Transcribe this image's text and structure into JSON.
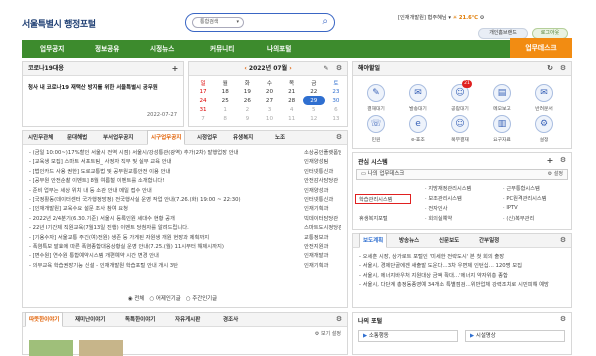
{
  "header": {
    "logo": "서울특별시 행정포털",
    "search_select": "통합검색",
    "user_info": "[인재개발원] 협주혜님",
    "weather": "21.6℃",
    "btn_homepage": "개인홈브랜드",
    "btn_logout": "로그아웃"
  },
  "gnb": {
    "items": [
      "업무공지",
      "정보공유",
      "시정뉴스",
      "커뮤니티",
      "나의포털"
    ],
    "mydesk": "업무데스크"
  },
  "corona": {
    "title": "코로나19대응",
    "text": "청사 내 코로나19 재택산 방지를 위한 서울특별시 공무원",
    "date": "2022-07-27"
  },
  "calendar": {
    "title": "2022년 07월",
    "weekdays": [
      "일",
      "월",
      "화",
      "수",
      "목",
      "금",
      "토"
    ],
    "rows": [
      [
        "17",
        "18",
        "19",
        "20",
        "21",
        "22",
        "23"
      ],
      [
        "24",
        "25",
        "26",
        "27",
        "28",
        "29",
        "30"
      ],
      [
        "31",
        "1",
        "2",
        "3",
        "4",
        "5",
        "6"
      ],
      [
        "7",
        "8",
        "9",
        "10",
        "11",
        "12",
        "13"
      ]
    ]
  },
  "favorites": {
    "title": "해야할일",
    "items": [
      "결재대기",
      "발송대기",
      "공람대기",
      "메모보고",
      "반려문서",
      "민원",
      "e-효조",
      "복무결재",
      "요구자료",
      "설정"
    ],
    "badge": "21"
  },
  "notice": {
    "tabs": [
      "시민무관체",
      "문대해법",
      "부서업무공지",
      "시구업무공지",
      "시정업무",
      "유생복지",
      "노조"
    ],
    "items": [
      {
        "title": "- (금일 10:00~)17%할인 서울시 전역 시점) 서울시/강성통관(광역) 추가(2차) 발행업장 안내",
        "dept": "소상공인플랫폼담당관"
      },
      {
        "title": "- [교육생 모집] 스마트 서포트팀_ 사정자 직무 및 실무 교육 안내",
        "dept": "인재양성팀"
      },
      {
        "title": "- [법인카드 사용 권한] 도로교통법 및 공무원교통안전 이용 안내",
        "dept": "인터넷통신과"
      },
      {
        "title": "- [공무원 안전순찰 이벤트] 8월 여름철 이벤트를 소개합니다!",
        "dept": "안전감사담당관"
      },
      {
        "title": "- 준비 업무는 세상 위치 내 등 소관 안내 메일 접수 안내",
        "dept": "인재양성과"
      },
      {
        "title": "- [국정활동(데이터센터 국가행정망정) 전국행사실 운영 작업 안내(7.26.(화) 19:00 ~ 22:30)",
        "dept": "인터넷통신과"
      },
      {
        "title": "- [인재개발원] 교육수요 설문 조사 참여 요청",
        "dept": "인재기획과"
      },
      {
        "title": "- 2022년 2/4분기(6.30.기준) 서울시 등록인원 세대수 현황 공개",
        "dept": "빅데이터담당관"
      },
      {
        "title": "- 22년 I기간제 직원교육(7월13일 진행) 이벤트 당첨자를 알려드립니다.",
        "dept": "스마트도시정당관"
      },
      {
        "title": "- [기용수자] 서울교통 주긴(여)전원) 생존 등 가게된 자원생 개원 현장과 제획까지",
        "dept": "교통정보과"
      },
      {
        "title": "- 폭염특보 발효에 따른 폭염종합대응상황실 운영 안내(7.25.(월) 11시부터 해제시까지)",
        "dept": "안전지원과"
      },
      {
        "title": "- [면수원] 연수원 통합예약시스템 개편예약 시간 변경 안내",
        "dept": "인재개발과"
      },
      {
        "title": "- 의무교육 학습권장기능 신설 - 인재개발원 학습포털 안내 개시 3탄",
        "dept": "인재기획과"
      }
    ],
    "radios": [
      "전체",
      "어제인기글",
      "주간인기글"
    ]
  },
  "bottom": {
    "tabs": [
      "따뜻한이야기",
      "재미난이야기",
      "독특한이야기",
      "자유게시판",
      "경조사"
    ],
    "more": "보기 설정"
  },
  "system": {
    "title": "관심 시스템",
    "mydesk": "나의 업무데스크",
    "setting": "설정",
    "col1": [
      "학습관리시스템",
      "휴생복지포털"
    ],
    "col2": [
      "지방재정관리시스템",
      "보조관리시스템",
      "전자인사",
      "회의실예약"
    ],
    "col3": [
      "근무통합시스템",
      "PC원격관리시스템",
      "IPTV",
      "(신)복무관리"
    ],
    "highlight": "학습관리시스템"
  },
  "press": {
    "tabs": [
      "보도계획",
      "방송뉴스",
      "신문보도",
      "간부일정"
    ],
    "items": [
      "- 오세훈 시장, 상가로트 포털인 '미세한 전략도시' 본 첫 회의 출장",
      "- 서울시, 경제단골에겐 새출발 도운다…3차 우면제 인턴십… 120명 모집",
      "- 서울시, 에너지바우처 지원대상 금액 확대…'에너지 약자위층 종합",
      "- 서울시, 다단계 총정동종영예 34개소 특별점검…위반업체 강력조치로 시민피해 예방"
    ]
  },
  "myportal": {
    "title": "나의 포털",
    "tabs": [
      "소통행동",
      "시설명상"
    ]
  },
  "colors": {
    "brand_green": "#3d8b2d",
    "accent_orange": "#f28c12",
    "highlight_red": "#e02020"
  }
}
